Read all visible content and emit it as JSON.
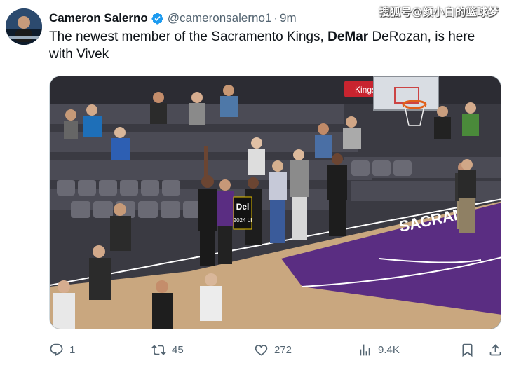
{
  "watermark": "搜狐号@颜小白的篮球梦",
  "tweet": {
    "display_name": "Cameron Salerno",
    "handle": "@cameronsalerno1",
    "separator": "·",
    "time": "9m",
    "text_part1": "The newest member of the Sacramento Kings, ",
    "text_bold": "DeMar",
    "text_part2": " DeRozan, is here with Vivek"
  },
  "media": {
    "court_text": "SACRAM",
    "sign_text": "Del",
    "sign_sub": "2024 LI",
    "banner_text": "Kings"
  },
  "actions": {
    "replies": "1",
    "retweets": "45",
    "likes": "272",
    "views": "9.4K"
  },
  "colors": {
    "verified": "#1d9bf0",
    "text": "#0f1419",
    "muted": "#536471",
    "kings_purple": "#5a2d82"
  },
  "icons": {
    "verified": "verified-badge-icon",
    "reply": "reply-icon",
    "retweet": "retweet-icon",
    "like": "heart-icon",
    "views": "views-chart-icon",
    "bookmark": "bookmark-icon",
    "share": "share-icon"
  }
}
